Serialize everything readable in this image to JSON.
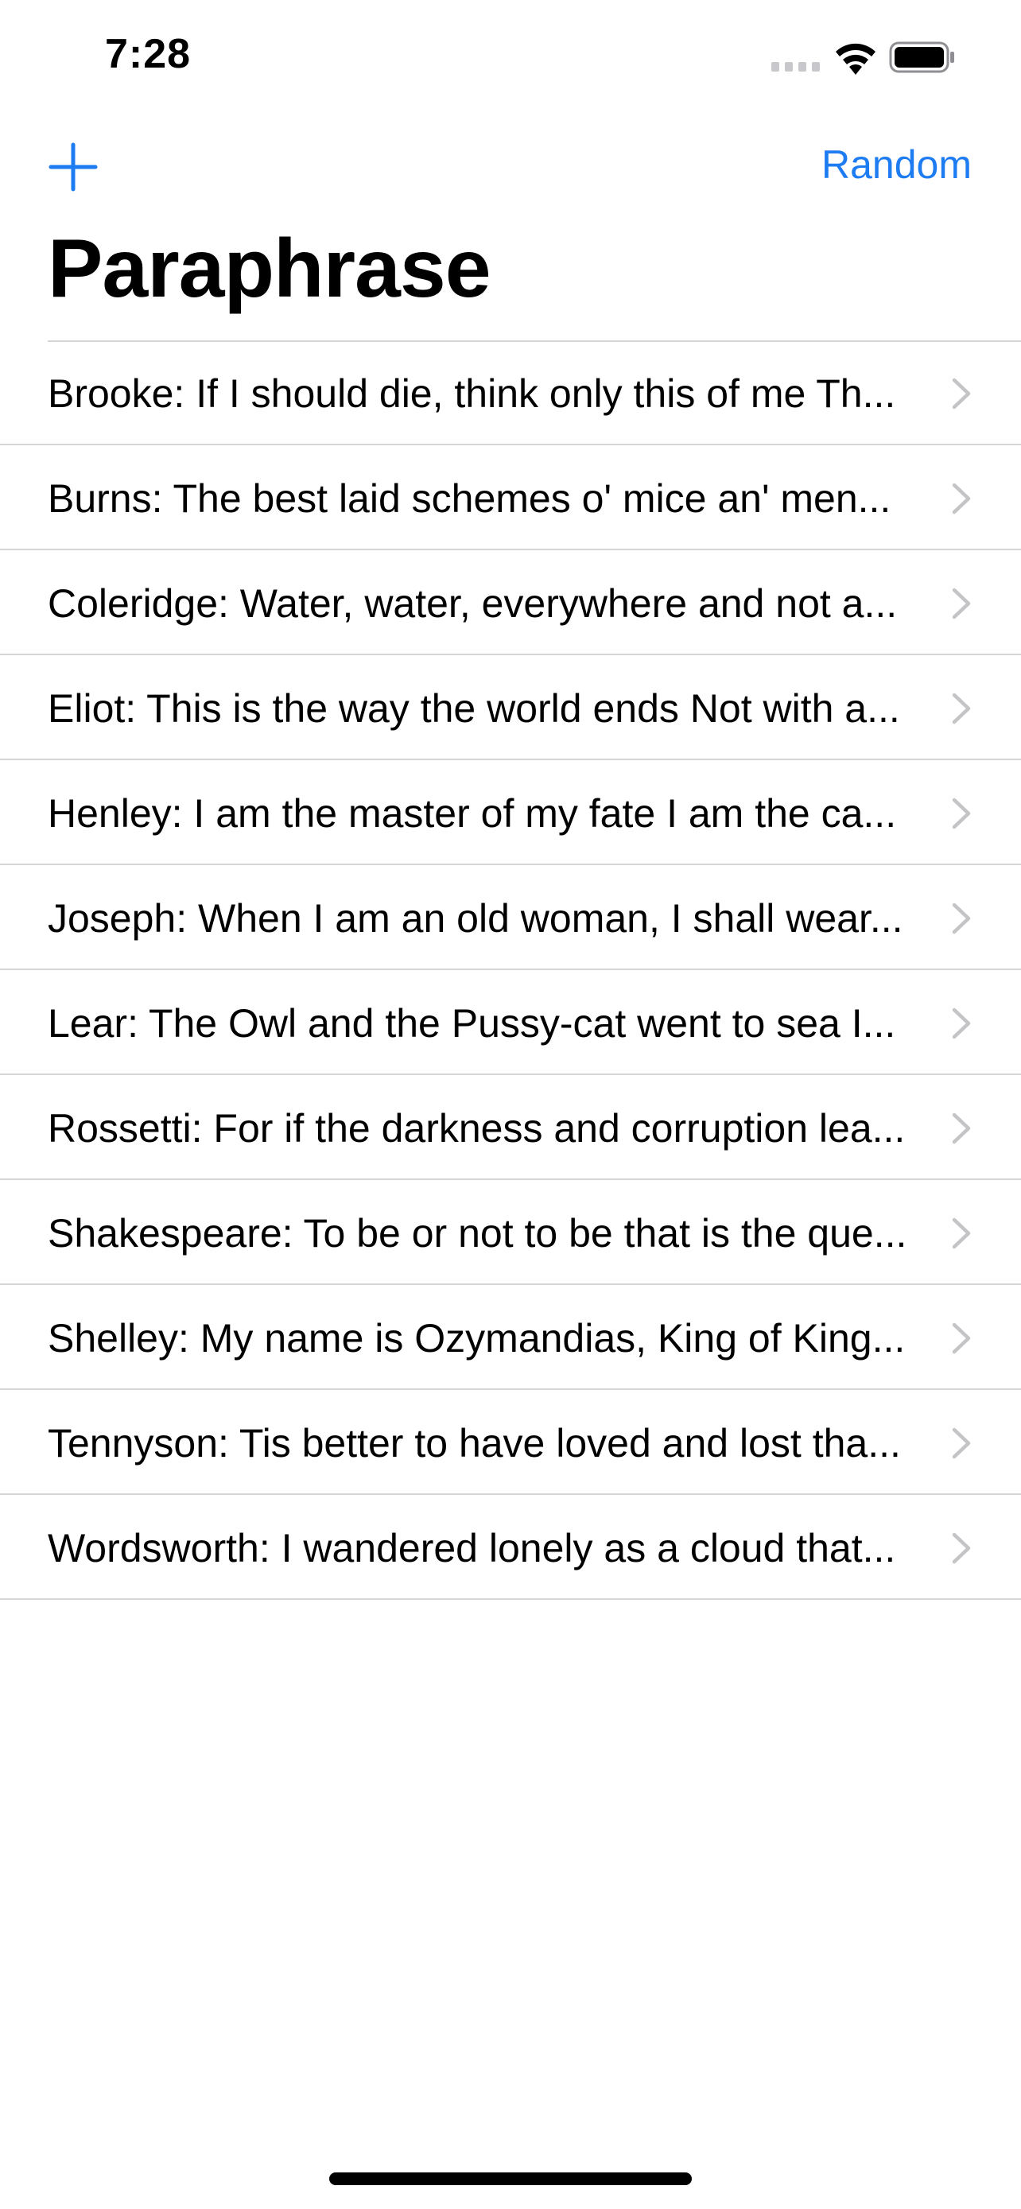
{
  "status_bar": {
    "time": "7:28"
  },
  "nav": {
    "add_icon": "plus-icon",
    "random_label": "Random"
  },
  "title": "Paraphrase",
  "colors": {
    "accent": "#1e7cf2",
    "separator": "#d6d6d9",
    "chevron": "#c4c4c7"
  },
  "rows": [
    {
      "text": "Brooke: If I should die, think only this of me Th..."
    },
    {
      "text": "Burns: The best laid schemes o' mice an' men..."
    },
    {
      "text": "Coleridge: Water, water, everywhere and not a..."
    },
    {
      "text": "Eliot: This is the way the world ends Not with a..."
    },
    {
      "text": "Henley: I am the master of my fate I am the ca..."
    },
    {
      "text": "Joseph: When I am an old woman, I shall wear..."
    },
    {
      "text": "Lear: The Owl and the Pussy-cat went to sea I..."
    },
    {
      "text": "Rossetti: For if the darkness and corruption lea..."
    },
    {
      "text": "Shakespeare: To be or not to be that is the que..."
    },
    {
      "text": "Shelley: My name is Ozymandias, King of King..."
    },
    {
      "text": "Tennyson: Tis better to have loved and lost tha..."
    },
    {
      "text": "Wordsworth: I wandered lonely as a cloud that..."
    }
  ]
}
